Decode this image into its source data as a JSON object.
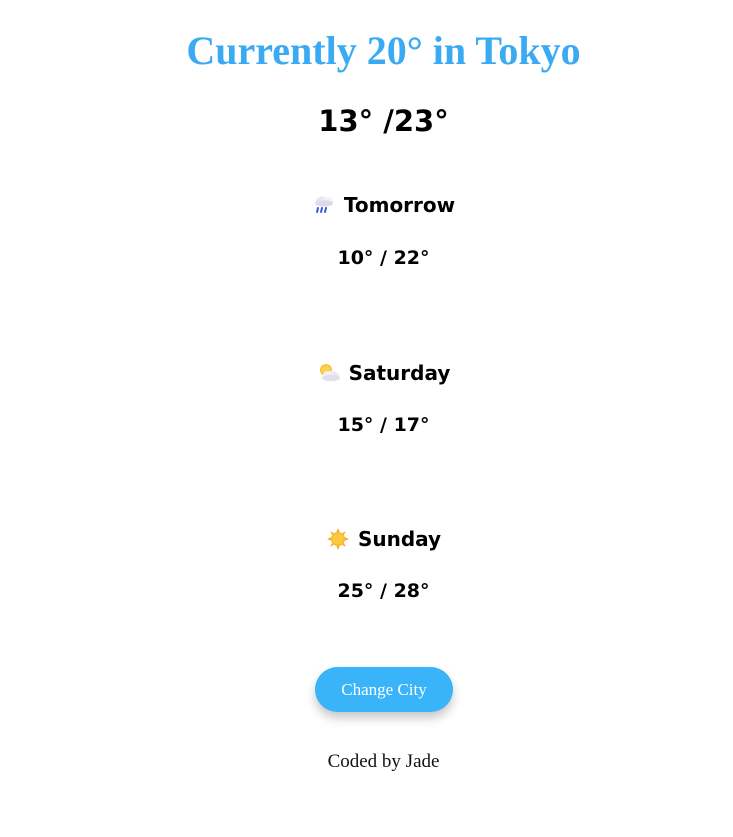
{
  "header": {
    "title": "Currently 20° in Tokyo",
    "today_range": "13° /23°"
  },
  "forecast": [
    {
      "day": "Tomorrow",
      "range": "10° / 22°",
      "icon": "rain-cloud-icon"
    },
    {
      "day": "Saturday",
      "range": "15° / 17°",
      "icon": "sun-behind-cloud-icon"
    },
    {
      "day": "Sunday",
      "range": "25° / 28°",
      "icon": "sun-icon"
    }
  ],
  "actions": {
    "change_city_label": "Change City"
  },
  "footer": {
    "credit": "Coded by Jade"
  },
  "colors": {
    "title": "#3aabf2",
    "button": "#3ab4f8"
  }
}
